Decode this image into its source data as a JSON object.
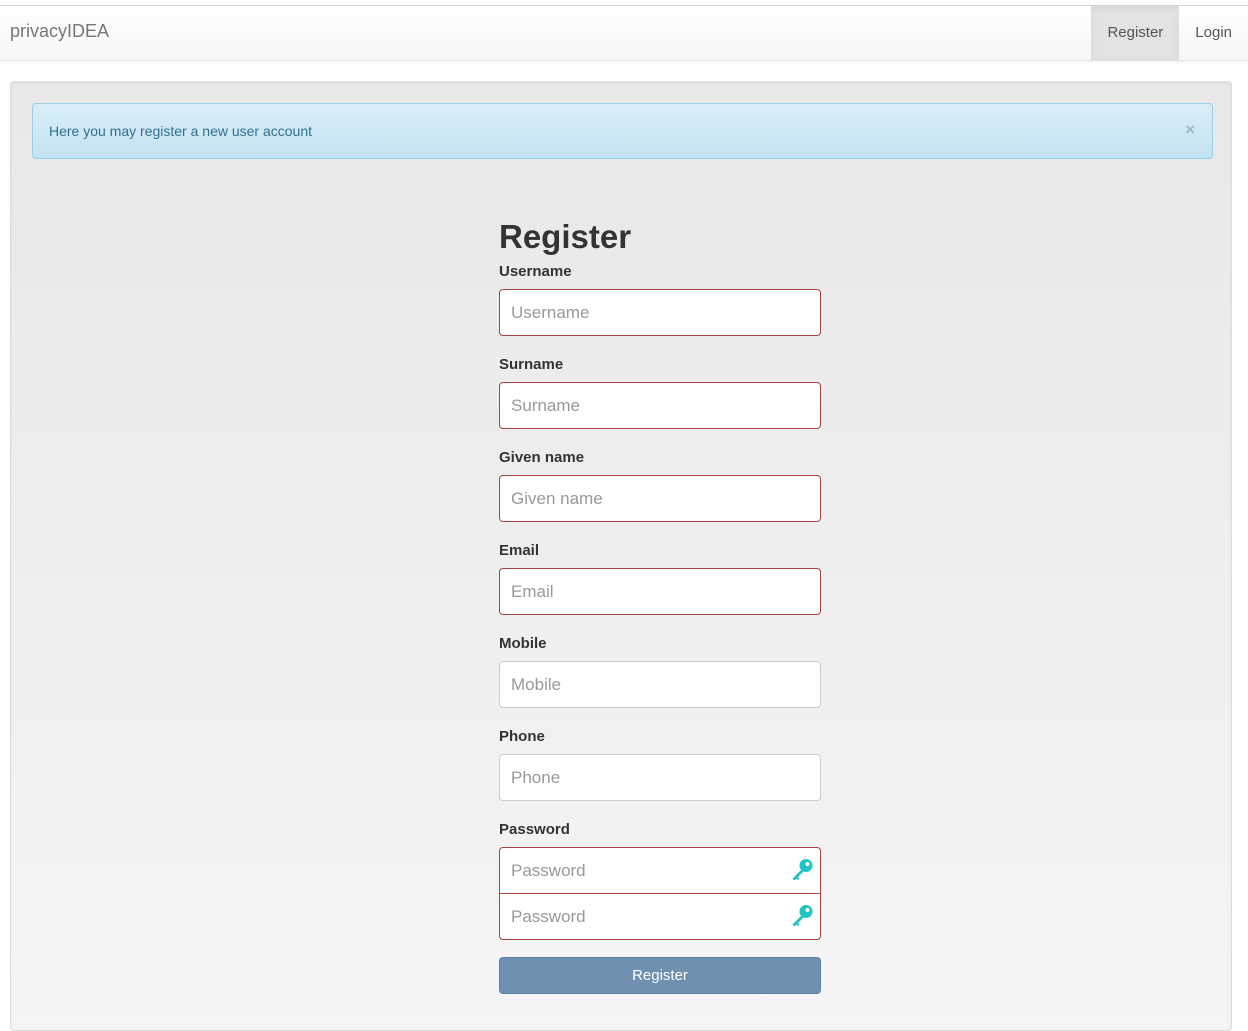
{
  "navbar": {
    "brand": "privacyIDEA",
    "links": [
      {
        "label": "Register",
        "active": true
      },
      {
        "label": "Login",
        "active": false
      }
    ]
  },
  "alert": {
    "message": "Here you may register a new user account",
    "close_symbol": "×"
  },
  "form": {
    "title": "Register",
    "fields": {
      "username": {
        "label": "Username",
        "placeholder": "Username",
        "value": ""
      },
      "surname": {
        "label": "Surname",
        "placeholder": "Surname",
        "value": ""
      },
      "givenname": {
        "label": "Given name",
        "placeholder": "Given name",
        "value": ""
      },
      "email": {
        "label": "Email",
        "placeholder": "Email",
        "value": ""
      },
      "mobile": {
        "label": "Mobile",
        "placeholder": "Mobile",
        "value": ""
      },
      "phone": {
        "label": "Phone",
        "placeholder": "Phone",
        "value": ""
      },
      "password": {
        "label": "Password",
        "placeholder": "Password",
        "confirm_placeholder": "Password",
        "value": ""
      }
    },
    "submit_label": "Register"
  },
  "icons": {
    "password_toggle": "key-icon",
    "key_color": "#20c4c4"
  },
  "colors": {
    "invalid_border": "#a94442",
    "alert_text": "#31708f",
    "submit_bg": "#6f90b1"
  }
}
